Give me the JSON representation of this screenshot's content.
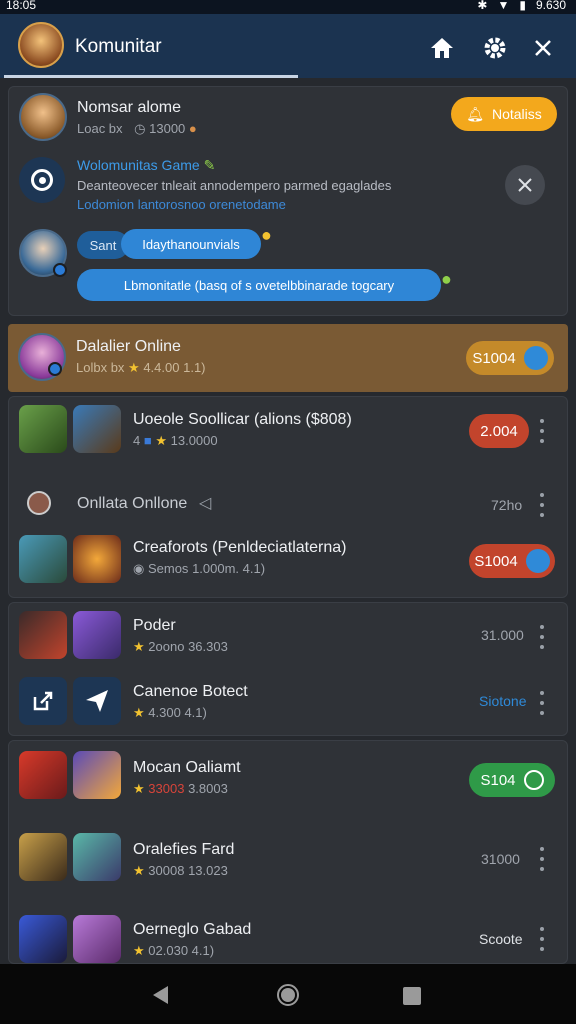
{
  "status": {
    "time": "18:05",
    "battery": "9.630"
  },
  "appbar": {
    "title": "Komunitar"
  },
  "notif": {
    "user_name": "Nomsar alome",
    "user_sub": "Loac bx",
    "user_count": "13000",
    "notify_label": "Notaliss",
    "game_title": "Wolomunitas Game",
    "game_desc1": "Deanteovecer tnleait annodempero parmed egaglades",
    "game_desc2": "Lodomion lantorosnoo orenetodame",
    "chip1": "Sant",
    "chip2": "Idaythanounvials",
    "chip3": "Lbmonitatle (basq of s ovetelbbinarade togcary"
  },
  "rows": [
    {
      "name": "Dalalier Online",
      "sub_a": "Lolbx bx",
      "rating": "4.4.00",
      "extra": "1.1)",
      "pill": "S1004"
    },
    {
      "name": "Uoeole Soollicar (alions ($808)",
      "sub_a": "4",
      "rating": "13.0000",
      "extra": "",
      "pill": "2.004"
    },
    {
      "name": "Onllata Onllone",
      "right": "72ho"
    },
    {
      "name": "Creaforots (Penldeciatlaterna)",
      "sub_a": "Semos",
      "rating": "1.000m.",
      "extra": "4.1)",
      "pill": "S1004"
    },
    {
      "name": "Poder",
      "sub_a": "2oono",
      "rating": "36.303",
      "right": "31.000"
    },
    {
      "name": "Canenoe Botect",
      "rating": "4.300",
      "extra": "4.1)",
      "right": "Siotone"
    },
    {
      "name": "Mocan Oaliamt",
      "rating": "33003",
      "extra": "3.8003",
      "pill": "S104"
    },
    {
      "name": "Oralefies Fard",
      "rating": "30008",
      "extra": "13.023",
      "right": "31000"
    },
    {
      "name": "Oerneglo Gabad",
      "rating": "02.030",
      "extra": "4.1)",
      "right": "Scoote"
    }
  ],
  "colors": {
    "orange": "#f3a81c",
    "red": "#c2442c",
    "green": "#2f9a48",
    "blue": "#2f8ad8",
    "highlight": "#7a5a34"
  }
}
